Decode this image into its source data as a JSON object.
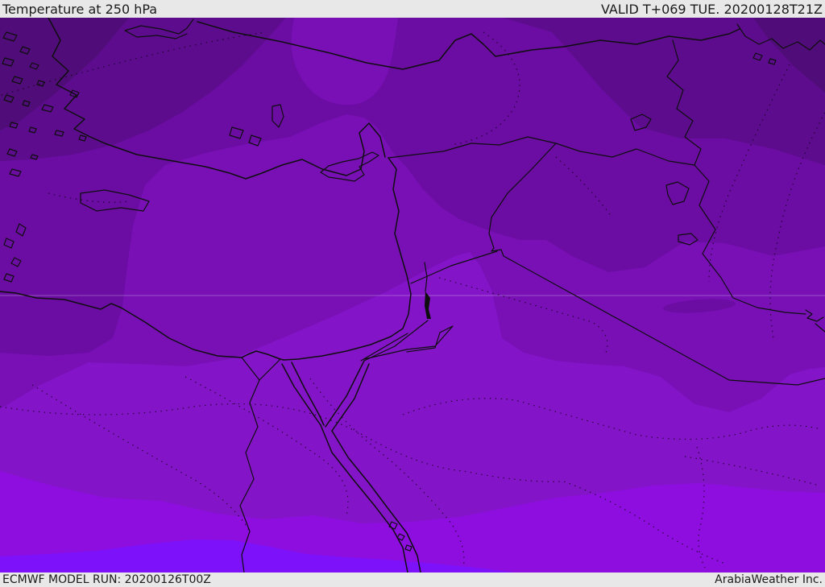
{
  "header": {
    "title": "Temperature at 250 hPa",
    "valid_time": "VALID T+069 TUE. 20200128T21Z"
  },
  "footer": {
    "model_run": "ECMWF MODEL RUN: 20200126T00Z",
    "credit": "ArabiaWeather Inc."
  },
  "map": {
    "parameter": "Temperature",
    "pressure_level": "250 hPa",
    "model": "ECMWF",
    "region": "Middle East / Eastern Mediterranean",
    "palette": {
      "c1": "#500c78",
      "c2": "#5d0c8e",
      "c3": "#6b0ca2",
      "c4": "#7810b6",
      "c5": "#8414c8",
      "c6": "#8d0edf",
      "c7": "#7c11fa",
      "border": "#0e0e0e",
      "graticule": "#c9a6e0",
      "bar_bg": "#e8e8e8",
      "bar_text": "#1b1b1b"
    }
  }
}
